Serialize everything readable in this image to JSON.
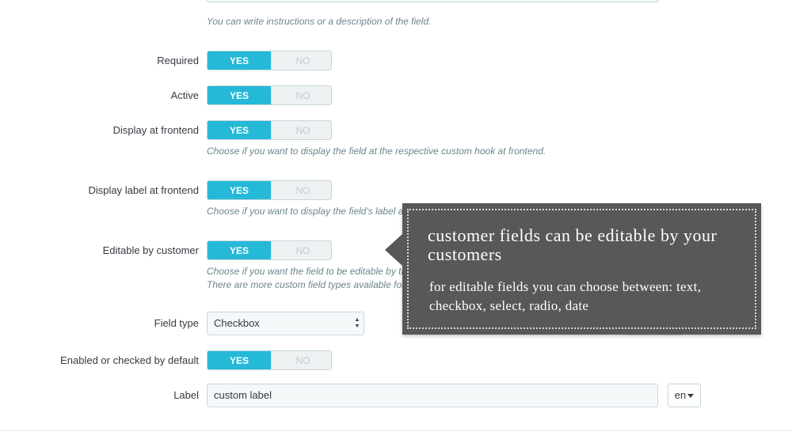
{
  "description_help": "You can write instructions or a description of the field.",
  "fields": {
    "required": {
      "label": "Required",
      "yes": "YES",
      "no": "NO"
    },
    "active": {
      "label": "Active",
      "yes": "YES",
      "no": "NO"
    },
    "display_frontend": {
      "label": "Display at frontend",
      "yes": "YES",
      "no": "NO",
      "help": "Choose if you want to display the field at the respective custom hook at frontend."
    },
    "display_label_frontend": {
      "label": "Display label at frontend",
      "yes": "YES",
      "no": "NO",
      "help": "Choose if you want to display the field's label a"
    },
    "editable_by_customer": {
      "label": "Editable by customer",
      "yes": "YES",
      "no": "NO",
      "help_line1": "Choose if you want the field to be editable by th",
      "help_line2": "There are more custom field types available for"
    },
    "field_type": {
      "label": "Field type",
      "value": "Checkbox"
    },
    "enabled_default": {
      "label": "Enabled or checked by default",
      "yes": "YES",
      "no": "NO"
    },
    "label_field": {
      "label": "Label",
      "value": "custom label",
      "lang": "en"
    }
  },
  "tooltip": {
    "title": "customer fields can be editable by your customers",
    "body": "for editable fields you can choose between: text, checkbox, select, radio, date"
  },
  "colors": {
    "accent": "#25b9d7",
    "tooltip_bg": "#58585a"
  },
  "icons": {
    "select_arrows": "updown-arrows-icon",
    "lang_caret": "caret-down-icon"
  }
}
